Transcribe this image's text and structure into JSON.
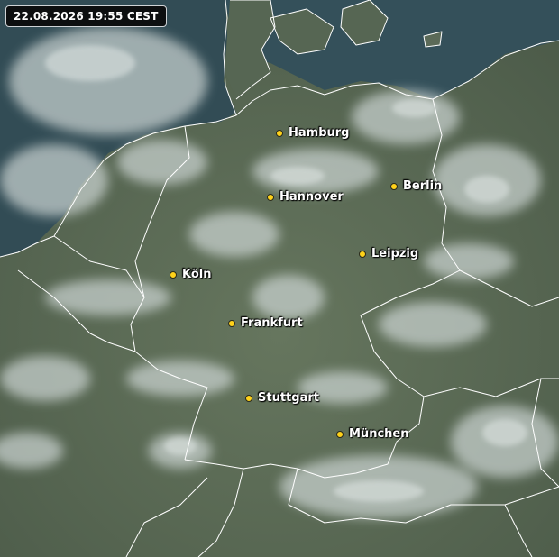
{
  "timestamp": "22.08.2026 19:55 CEST",
  "colors": {
    "land": "#5a6a55",
    "sea": "#2f4a52",
    "cloud": "#cfd8d6",
    "border": "#ffffff",
    "city_dot": "#ffd21a"
  },
  "cities": [
    {
      "name": "Hamburg"
    },
    {
      "name": "Hannover"
    },
    {
      "name": "Berlin"
    },
    {
      "name": "Leipzig"
    },
    {
      "name": "Köln"
    },
    {
      "name": "Frankfurt"
    },
    {
      "name": "Stuttgart"
    },
    {
      "name": "München"
    }
  ]
}
